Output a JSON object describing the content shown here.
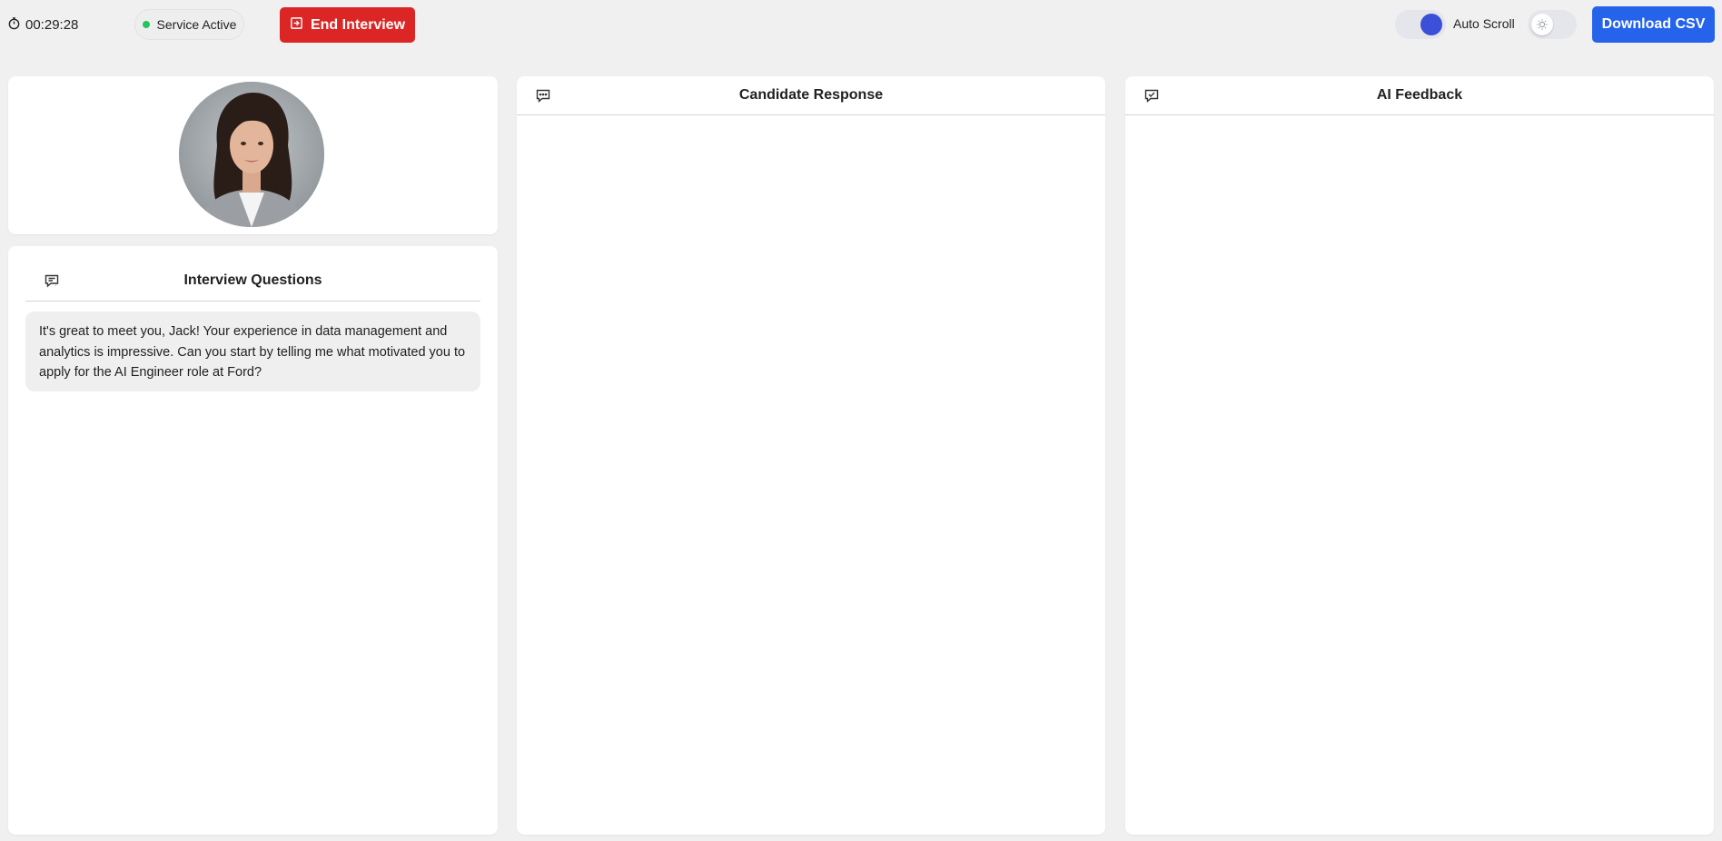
{
  "header": {
    "timer": "00:29:28",
    "status": {
      "label": "Service Active",
      "color": "#22c55e"
    },
    "end_button": {
      "label": "End Interview",
      "icon": "exit-icon",
      "color": "#dc2626"
    },
    "auto_scroll": {
      "label": "Auto Scroll",
      "enabled": true
    },
    "theme_toggle": {
      "icon": "sun-icon",
      "dark_mode": false
    },
    "download_button": {
      "label": "Download CSV",
      "color": "#2563eb"
    }
  },
  "interviewer": {
    "avatar_icon": "interviewer-avatar"
  },
  "questions": {
    "title": "Interview Questions",
    "icon": "message-question-icon",
    "items": [
      {
        "text": "It's great to meet you, Jack! Your experience in data management and analytics is impressive. Can you start by telling me what motivated you to apply for the AI Engineer role at Ford?"
      }
    ]
  },
  "candidate_response": {
    "title": "Candidate Response",
    "icon": "message-dots-icon"
  },
  "ai_feedback": {
    "title": "AI Feedback",
    "icon": "message-check-icon"
  }
}
